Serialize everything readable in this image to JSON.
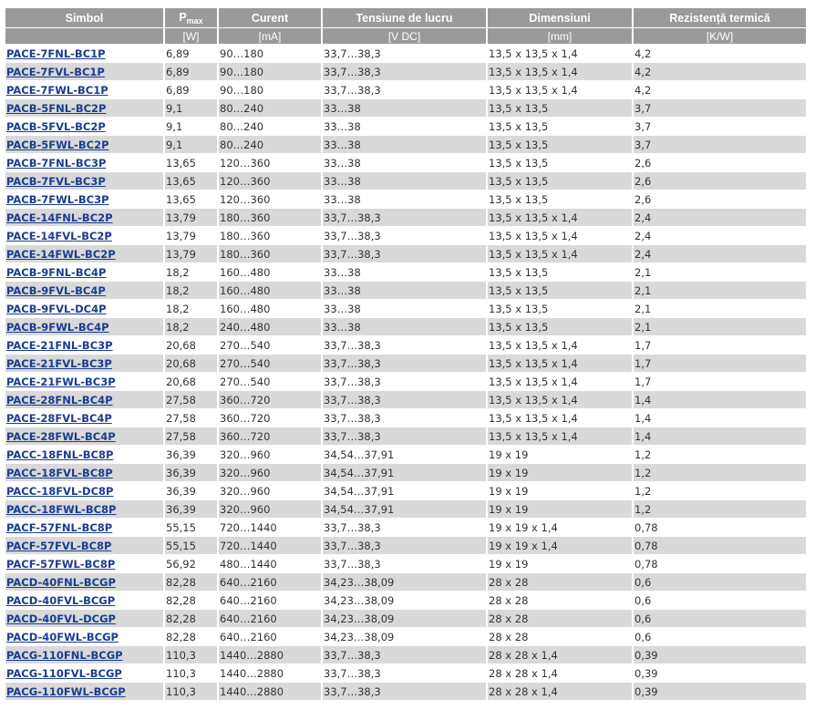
{
  "header": {
    "cols": [
      "Simbol",
      "P",
      "Curent",
      "Tensiune de lucru",
      "Dimensiuni",
      "Rezistență termică"
    ],
    "pmax_sub": "max",
    "units": [
      "",
      "[W]",
      "[mA]",
      "[V DC]",
      "[mm]",
      "[K/W]"
    ]
  },
  "rows": [
    [
      "PACE-7FNL-BC1P",
      "6,89",
      "90…180",
      "33,7…38,3",
      "13,5 x 13,5 x 1,4",
      "4,2"
    ],
    [
      "PACE-7FVL-BC1P",
      "6,89",
      "90…180",
      "33,7…38,3",
      "13,5 x 13,5 x 1,4",
      "4,2"
    ],
    [
      "PACE-7FWL-BC1P",
      "6,89",
      "90…180",
      "33,7…38,3",
      "13,5 x 13,5 x 1,4",
      "4,2"
    ],
    [
      "PACB-5FNL-BC2P",
      "9,1",
      "80…240",
      "33…38",
      "13,5 x 13,5",
      "3,7"
    ],
    [
      "PACB-5FVL-BC2P",
      "9,1",
      "80…240",
      "33…38",
      "13,5 x 13,5",
      "3,7"
    ],
    [
      "PACB-5FWL-BC2P",
      "9,1",
      "80…240",
      "33…38",
      "13,5 x 13,5",
      "3,7"
    ],
    [
      "PACB-7FNL-BC3P",
      "13,65",
      "120…360",
      "33…38",
      "13,5 x 13,5",
      "2,6"
    ],
    [
      "PACB-7FVL-BC3P",
      "13,65",
      "120…360",
      "33…38",
      "13,5 x 13,5",
      "2,6"
    ],
    [
      "PACB-7FWL-BC3P",
      "13,65",
      "120…360",
      "33…38",
      "13,5 x 13,5",
      "2,6"
    ],
    [
      "PACE-14FNL-BC2P",
      "13,79",
      "180…360",
      "33,7…38,3",
      "13,5 x 13,5 x 1,4",
      "2,4"
    ],
    [
      "PACE-14FVL-BC2P",
      "13,79",
      "180…360",
      "33,7…38,3",
      "13,5 x 13,5 x 1,4",
      "2,4"
    ],
    [
      "PACE-14FWL-BC2P",
      "13,79",
      "180…360",
      "33,7…38,3",
      "13,5 x 13,5 x 1,4",
      "2,4"
    ],
    [
      "PACB-9FNL-BC4P",
      "18,2",
      "160…480",
      "33…38",
      "13,5 x 13,5",
      "2,1"
    ],
    [
      "PACB-9FVL-BC4P",
      "18,2",
      "160…480",
      "33…38",
      "13,5 x 13,5",
      "2,1"
    ],
    [
      "PACB-9FVL-DC4P",
      "18,2",
      "160…480",
      "33…38",
      "13,5 x 13,5",
      "2,1"
    ],
    [
      "PACB-9FWL-BC4P",
      "18,2",
      "240…480",
      "33…38",
      "13,5 x 13,5",
      "2,1"
    ],
    [
      "PACE-21FNL-BC3P",
      "20,68",
      "270…540",
      "33,7…38,3",
      "13,5 x 13,5 x 1,4",
      "1,7"
    ],
    [
      "PACE-21FVL-BC3P",
      "20,68",
      "270…540",
      "33,7…38,3",
      "13,5 x 13,5 x 1,4",
      "1,7"
    ],
    [
      "PACE-21FWL-BC3P",
      "20,68",
      "270…540",
      "33,7…38,3",
      "13,5 x 13,5 x 1,4",
      "1,7"
    ],
    [
      "PACE-28FNL-BC4P",
      "27,58",
      "360…720",
      "33,7…38,3",
      "13,5 x 13,5 x 1,4",
      "1,4"
    ],
    [
      "PACE-28FVL-BC4P",
      "27,58",
      "360…720",
      "33,7…38,3",
      "13,5 x 13,5 x 1,4",
      "1,4"
    ],
    [
      "PACE-28FWL-BC4P",
      "27,58",
      "360…720",
      "33,7…38,3",
      "13,5 x 13,5 x 1,4",
      "1,4"
    ],
    [
      "PACC-18FNL-BC8P",
      "36,39",
      "320…960",
      "34,54…37,91",
      "19 x 19",
      "1,2"
    ],
    [
      "PACC-18FVL-BC8P",
      "36,39",
      "320…960",
      "34,54…37,91",
      "19 x 19",
      "1,2"
    ],
    [
      "PACC-18FVL-DC8P",
      "36,39",
      "320…960",
      "34,54…37,91",
      "19 x 19",
      "1,2"
    ],
    [
      "PACC-18FWL-BC8P",
      "36,39",
      "320…960",
      "34,54…37,91",
      "19 x 19",
      "1,2"
    ],
    [
      "PACF-57FNL-BC8P",
      "55,15",
      "720…1440",
      "33,7…38,3",
      "19 x 19 x 1,4",
      "0,78"
    ],
    [
      "PACF-57FVL-BC8P",
      "55,15",
      "720…1440",
      "33,7…38,3",
      "19 x 19 x 1,4",
      "0,78"
    ],
    [
      "PACF-57FWL-BC8P",
      "56,92",
      "480…1440",
      "33,7…38,3",
      "19 x 19",
      "0,78"
    ],
    [
      "PACD-40FNL-BCGP",
      "82,28",
      "640…2160",
      "34,23…38,09",
      "28 x 28",
      "0,6"
    ],
    [
      "PACD-40FVL-BCGP",
      "82,28",
      "640…2160",
      "34,23…38,09",
      "28 x 28",
      "0,6"
    ],
    [
      "PACD-40FVL-DCGP",
      "82,28",
      "640…2160",
      "34,23…38,09",
      "28 x 28",
      "0,6"
    ],
    [
      "PACD-40FWL-BCGP",
      "82,28",
      "640…2160",
      "34,23…38,09",
      "28 x 28",
      "0,6"
    ],
    [
      "PACG-110FNL-BCGP",
      "110,3",
      "1440…2880",
      "33,7…38,3",
      "28 x 28 x 1,4",
      "0,39"
    ],
    [
      "PACG-110FVL-BCGP",
      "110,3",
      "1440…2880",
      "33,7…38,3",
      "28 x 28 x 1,4",
      "0,39"
    ],
    [
      "PACG-110FWL-BCGP",
      "110,3",
      "1440…2880",
      "33,7…38,3",
      "28 x 28 x 1,4",
      "0,39"
    ]
  ]
}
